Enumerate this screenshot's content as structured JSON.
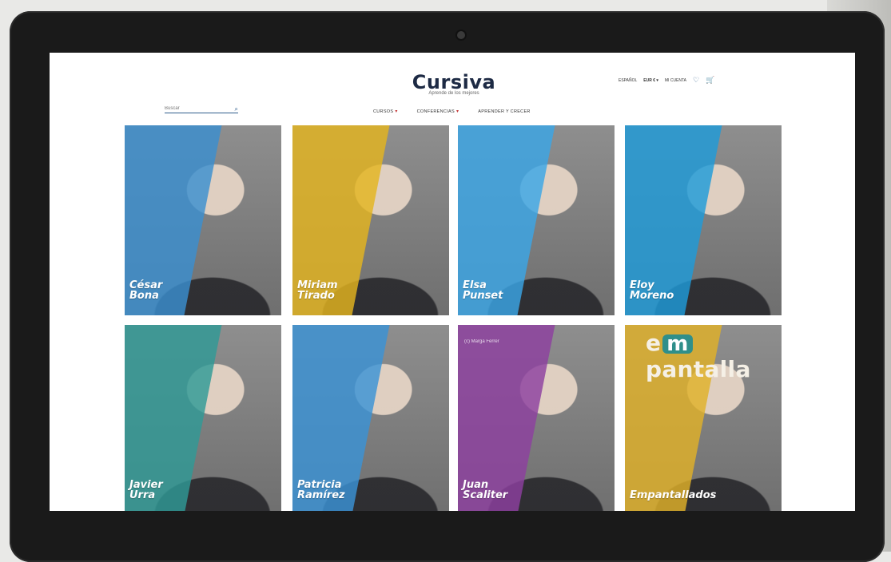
{
  "header": {
    "brand": "Cursiva",
    "tagline": "Aprende de los mejores"
  },
  "search": {
    "placeholder": "Buscar"
  },
  "topbar": {
    "language": "ESPAÑOL",
    "currency": "EUR €",
    "account": "MI CUENTA",
    "icons": [
      "heart-icon",
      "cart-icon"
    ]
  },
  "nav": {
    "items": [
      {
        "label": "CURSOS",
        "has_dropdown": true
      },
      {
        "label": "CONFERENCIAS",
        "has_dropdown": true
      },
      {
        "label": "APRENDER Y CRECER",
        "has_dropdown": false
      }
    ]
  },
  "cards": [
    {
      "name": "César\nBona",
      "tint": "#3b8fd0"
    },
    {
      "name": "Miriam\nTirado",
      "tint": "#e4b41f"
    },
    {
      "name": "Elsa\nPunset",
      "tint": "#3aa6e6"
    },
    {
      "name": "Eloy\nMoreno",
      "tint": "#1f9bd9"
    },
    {
      "name": "Javier\nUrra",
      "tint": "#2f9a96"
    },
    {
      "name": "Patricia\nRamírez",
      "tint": "#3a92d6"
    },
    {
      "name": "Juan\nScaliter",
      "tint": "#8e3fa0",
      "photo_credit": "(c) Marga Ferrer"
    },
    {
      "name": "Empantallados",
      "tint": "#e0b128",
      "brand_text": "empantalla"
    }
  ]
}
